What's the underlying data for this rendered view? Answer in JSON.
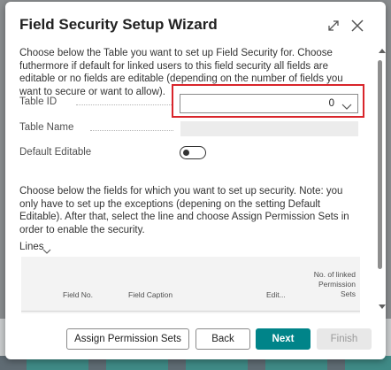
{
  "dialog": {
    "title": "Field Security Setup Wizard",
    "instructions_top": "Choose below the Table you want to set up Field Security for. Choose futhermore if default for linked users to this field security all fields are editable or no fields are editable (depending on the number of fields you want to secure or want to allow).",
    "instructions_bottom": "Choose below the fields for which you want to set up security. Note: you only have to set up the exceptions (depening on the setting Default Editable). After that, select the line and choose Assign Permission Sets in order to enable the security."
  },
  "fields": {
    "table_id_label": "Table ID",
    "table_id_value": "0",
    "table_name_label": "Table Name",
    "table_name_value": "",
    "default_editable_label": "Default Editable",
    "default_editable_on": false
  },
  "lines": {
    "header": "Lines",
    "columns": {
      "field_no": "Field No.",
      "field_caption": "Field Caption",
      "edit": "Edit...",
      "linked_line1": "No. of linked",
      "linked_line2": "Permission",
      "linked_line3": "Sets"
    }
  },
  "buttons": {
    "assign": "Assign Permission Sets",
    "back": "Back",
    "next": "Next",
    "finish": "Finish"
  },
  "colors": {
    "accent": "#008489",
    "highlight": "#d9252b"
  },
  "icons": {
    "expand": "expand-icon",
    "close": "close-icon",
    "dropdown": "chevron-down-icon"
  }
}
